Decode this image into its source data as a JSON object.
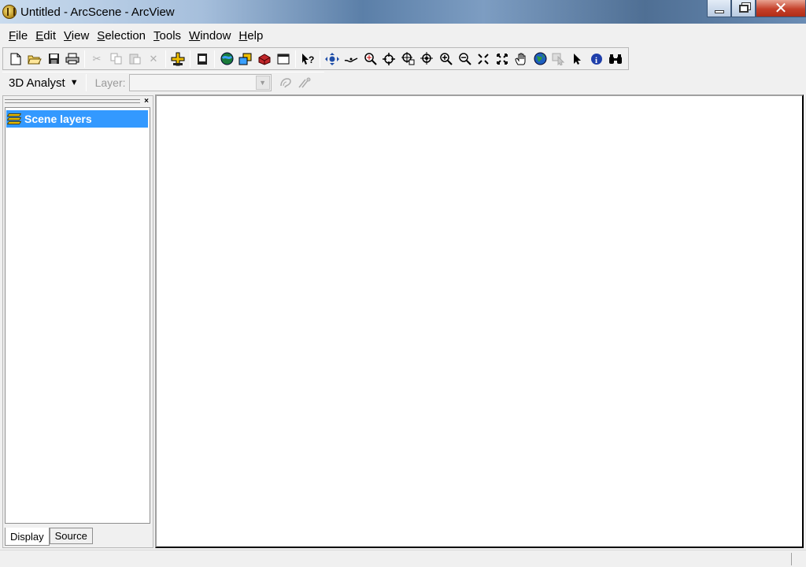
{
  "window": {
    "title": "Untitled - ArcScene - ArcView",
    "close_glyph": "✕"
  },
  "menu": [
    {
      "label": "File",
      "underline": "F",
      "rest": "ile"
    },
    {
      "label": "Edit",
      "underline": "E",
      "rest": "dit"
    },
    {
      "label": "View",
      "underline": "V",
      "rest": "iew"
    },
    {
      "label": "Selection",
      "underline": "S",
      "rest": "election"
    },
    {
      "label": "Tools",
      "underline": "T",
      "rest": "ools"
    },
    {
      "label": "Window",
      "underline": "W",
      "rest": "indow"
    },
    {
      "label": "Help",
      "underline": "H",
      "rest": "elp"
    }
  ],
  "toolbar_icons": [
    "new-document-icon",
    "open-folder-icon",
    "save-icon",
    "print-icon",
    "cut-icon",
    "copy-icon",
    "paste-icon",
    "delete-icon",
    "add-data-icon",
    "arctoolbox-icon",
    "scene-properties-icon",
    "animation-icon",
    "3d-view-icon",
    "layer-properties-icon",
    "whats-this-icon",
    "navigate-icon",
    "fly-icon",
    "zoom-to-target-icon",
    "center-on-target-icon",
    "set-observer-icon",
    "narrow-fov-icon",
    "zoom-in-icon",
    "zoom-out-icon",
    "fixed-zoom-in-icon",
    "full-extent-icon",
    "pan-icon",
    "globe-icon",
    "identify-disabled-icon",
    "select-elements-icon",
    "identify-icon",
    "find-icon"
  ],
  "analyst_toolbar": {
    "label": "3D Analyst",
    "layer_label": "Layer:",
    "layer_value": ""
  },
  "toc": {
    "root_label": "Scene layers",
    "tabs": [
      "Display",
      "Source"
    ],
    "close_glyph": "×"
  }
}
